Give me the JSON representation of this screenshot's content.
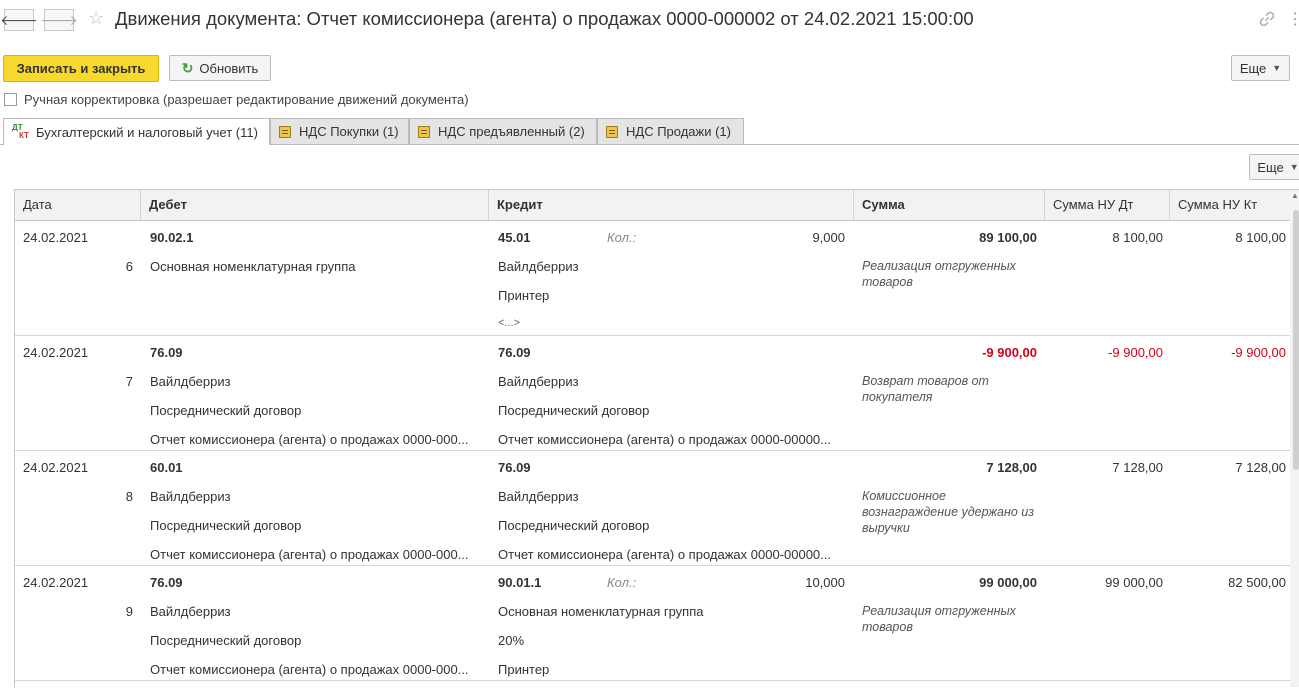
{
  "window": {
    "title": "Движения документа: Отчет комиссионера (агента) о продажах 0000-000002 от 24.02.2021 15:00:00",
    "back_glyph": "🡐",
    "forward_glyph": "🡒",
    "star_glyph": "☆",
    "menu_glyph": "⋮"
  },
  "toolbar": {
    "save_close_label": "Записать и закрыть",
    "refresh_label": "Обновить",
    "more_label": "Еще"
  },
  "manual_edit": {
    "label": "Ручная корректировка (разрешает редактирование движений документа)",
    "checked": false
  },
  "tabs": [
    {
      "label": "Бухгалтерский и налоговый учет (11)",
      "icon": "dt-kt-icon",
      "active": true
    },
    {
      "label": "НДС Покупки (1)",
      "icon": "register-icon",
      "active": false
    },
    {
      "label": "НДС предъявленный (2)",
      "icon": "register-icon",
      "active": false
    },
    {
      "label": "НДС Продажи (1)",
      "icon": "register-icon",
      "active": false
    }
  ],
  "grid_more_label": "Еще",
  "table": {
    "columns": [
      "Дата",
      "Дебет",
      "Кредит",
      "Сумма",
      "Сумма НУ Дт",
      "Сумма НУ Кт"
    ],
    "qty_label": "Кол.:",
    "rows": [
      {
        "date": "24.02.2021",
        "num": "6",
        "debit": [
          "90.02.1",
          "Основная номенклатурная группа",
          "",
          ""
        ],
        "credit": [
          "45.01",
          "Вайлдберриз",
          "Принтер",
          "<...>"
        ],
        "qty": "9,000",
        "sum": "89 100,00",
        "sum_nu_dt": "8 100,00",
        "sum_nu_kt": "8 100,00",
        "comment": "Реализация отгруженных товаров",
        "negative": false
      },
      {
        "date": "24.02.2021",
        "num": "7",
        "debit": [
          "76.09",
          "Вайлдберриз",
          "Посреднический договор",
          "Отчет комиссионера (агента) о продажах 0000-000..."
        ],
        "credit": [
          "76.09",
          "Вайлдберриз",
          "Посреднический договор",
          "Отчет комиссионера (агента) о продажах 0000-00000..."
        ],
        "qty": "",
        "sum": "-9 900,00",
        "sum_nu_dt": "-9 900,00",
        "sum_nu_kt": "-9 900,00",
        "comment": "Возврат товаров от покупателя",
        "negative": true
      },
      {
        "date": "24.02.2021",
        "num": "8",
        "debit": [
          "60.01",
          "Вайлдберриз",
          "Посреднический договор",
          "Отчет комиссионера (агента) о продажах 0000-000..."
        ],
        "credit": [
          "76.09",
          "Вайлдберриз",
          "Посреднический договор",
          "Отчет комиссионера (агента) о продажах 0000-00000..."
        ],
        "qty": "",
        "sum": "7 128,00",
        "sum_nu_dt": "7 128,00",
        "sum_nu_kt": "7 128,00",
        "comment": "Комиссионное вознаграждение удержано из выручки",
        "negative": false
      },
      {
        "date": "24.02.2021",
        "num": "9",
        "debit": [
          "76.09",
          "Вайлдберриз",
          "Посреднический договор",
          "Отчет комиссионера (агента) о продажах 0000-000..."
        ],
        "credit": [
          "90.01.1",
          "Основная номенклатурная группа",
          "20%",
          "Принтер"
        ],
        "qty": "10,000",
        "sum": "99 000,00",
        "sum_nu_dt": "99 000,00",
        "sum_nu_kt": "82 500,00",
        "comment": "Реализация отгруженных товаров",
        "negative": false
      }
    ]
  }
}
